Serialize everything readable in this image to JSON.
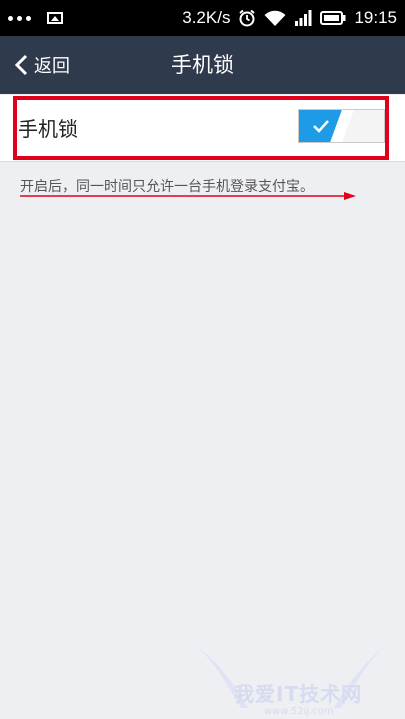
{
  "status_bar": {
    "speed": "3.2K/s",
    "time": "19:15"
  },
  "nav": {
    "back_label": "返回",
    "title": "手机锁"
  },
  "setting": {
    "label": "手机锁",
    "toggle_on": true
  },
  "description": "开启后，同一时间只允许一台手机登录支付宝。",
  "watermark": {
    "text": "我爱IT技术网",
    "url": "www.52ij.com"
  },
  "colors": {
    "nav_bg": "#2f3a4d",
    "toggle_blue": "#1e9be6",
    "highlight_red": "#e0001b",
    "background": "#eeeff3"
  }
}
